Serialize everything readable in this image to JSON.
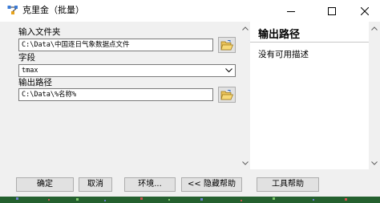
{
  "window": {
    "title": "克里金（批量）"
  },
  "form": {
    "input_folder_label": "输入文件夹",
    "input_folder_value": "C:\\Data\\中国逐日气象数据点文件",
    "field_label": "字段",
    "field_value": "tmax",
    "output_path_label": "输出路径",
    "output_path_value": "C:\\Data\\%名称%"
  },
  "help_panel": {
    "title": "输出路径",
    "text": "没有可用描述"
  },
  "buttons": {
    "ok": "确定",
    "cancel": "取消",
    "environments": "环境...",
    "hide_help": "<< 隐藏帮助",
    "tool_help": "工具帮助"
  },
  "icons": {
    "app": "model-tool-icon",
    "folder": "open-folder-icon",
    "dropdown": "chevron-down-icon"
  }
}
